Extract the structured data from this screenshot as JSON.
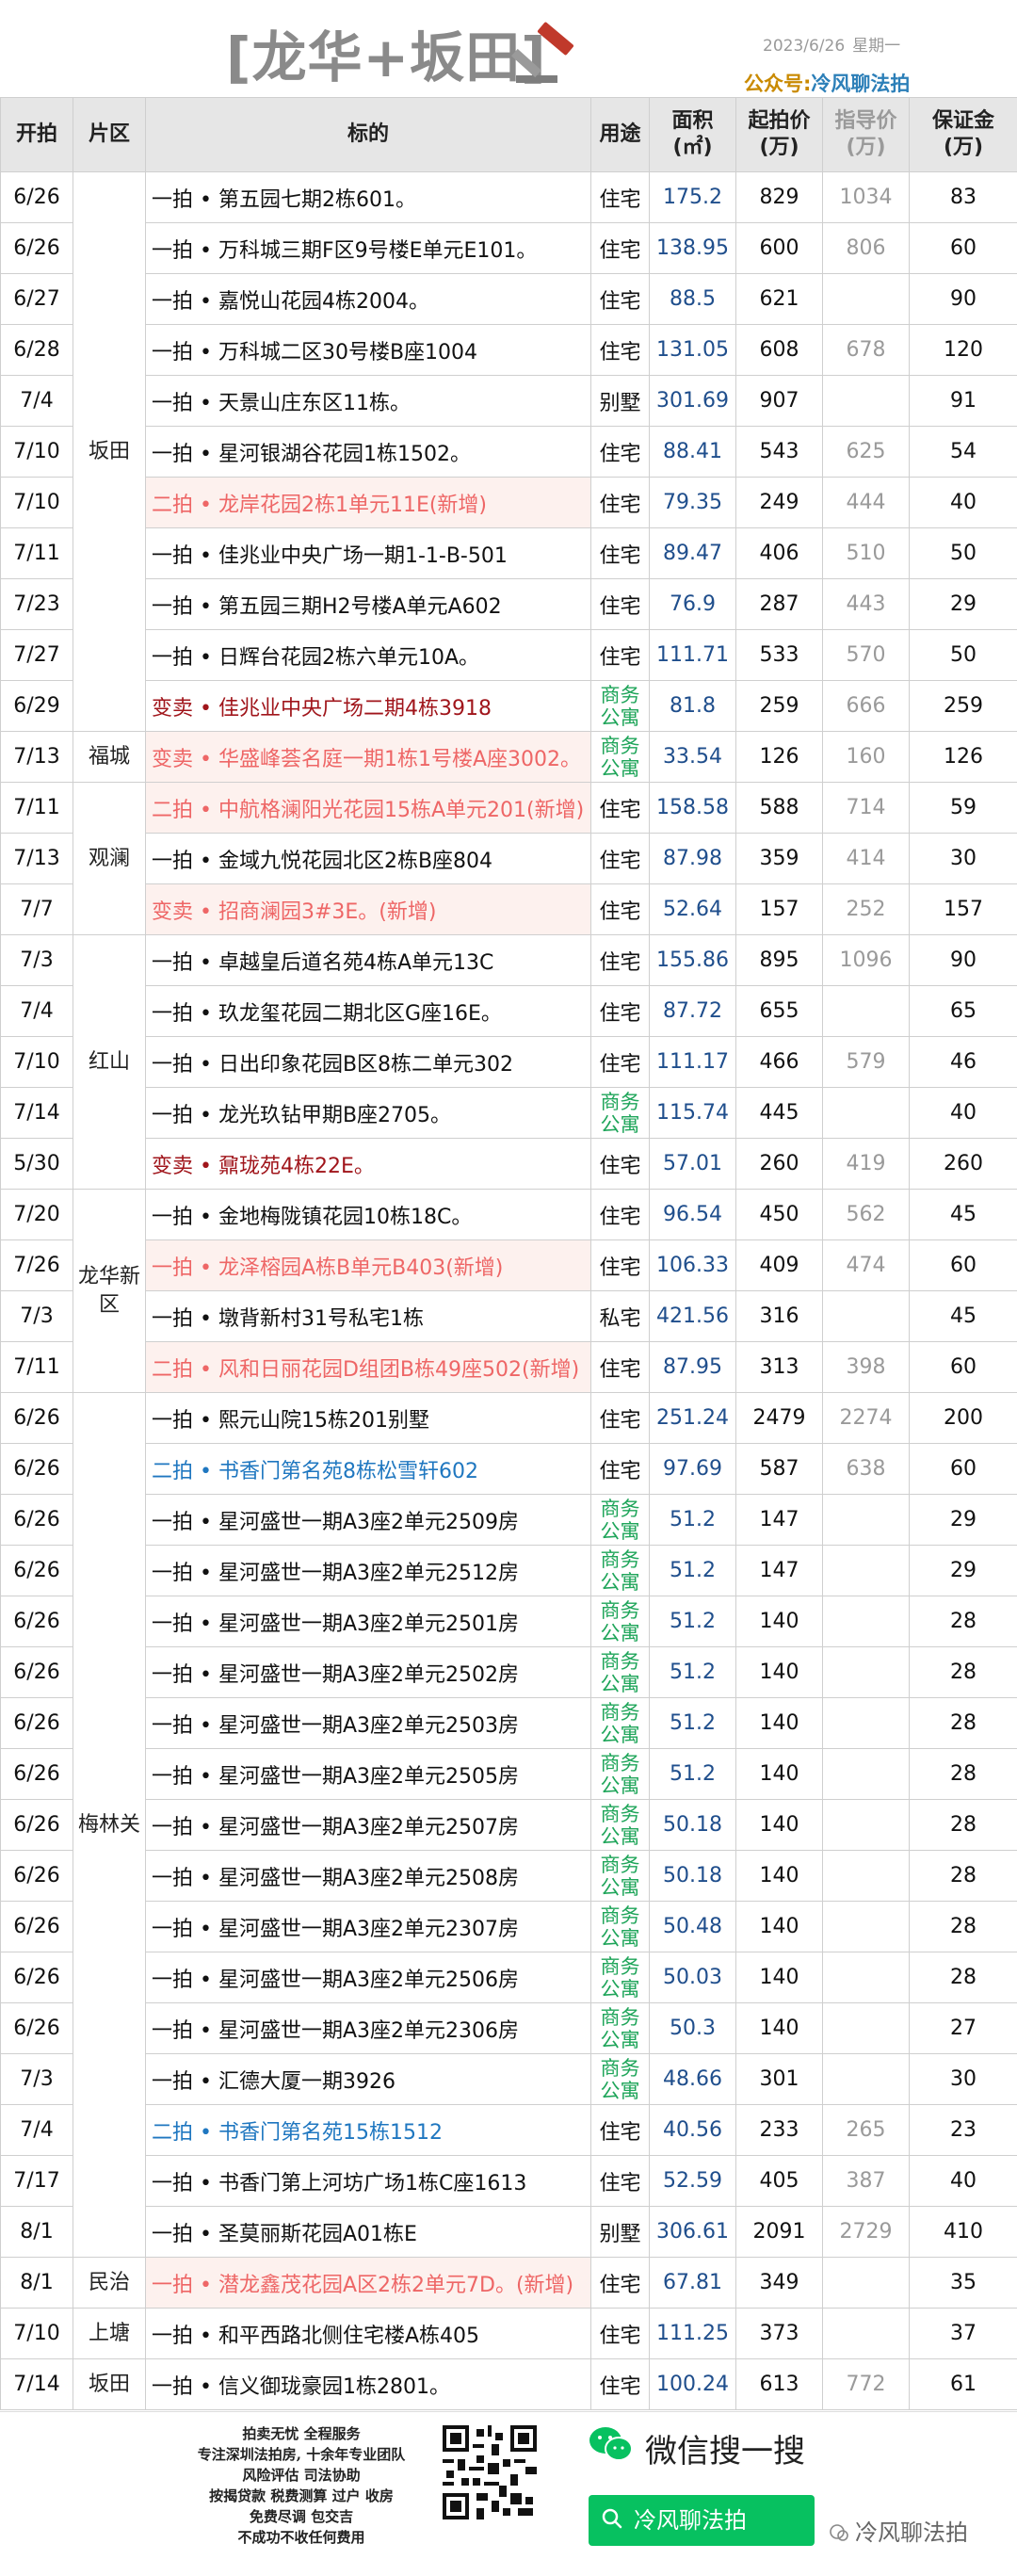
{
  "header": {
    "title": "[龙华+坂田]",
    "date": "2023/6/26",
    "weekday": "星期一",
    "gzh_label": "公众号:",
    "gzh_name": "冷风聊法拍"
  },
  "table": {
    "headers": {
      "date": "开拍",
      "zone": "片区",
      "name": "标的",
      "use": "用途",
      "area": "面积",
      "area_unit": "(㎡)",
      "price": "起拍价",
      "price_unit": "(万)",
      "guide": "指导价",
      "guide_unit": "(万)",
      "deposit": "保证金",
      "deposit_unit": "(万)"
    },
    "rows": [
      {
        "date": "6/26",
        "name": "一拍 • 第五园七期2栋601。",
        "use": "住宅",
        "area": "175.2",
        "price": "829",
        "guide": "1034",
        "deposit": "83",
        "style": ""
      },
      {
        "date": "6/26",
        "name": "一拍 • 万科城三期F区9号楼E单元E101。",
        "use": "住宅",
        "area": "138.95",
        "price": "600",
        "guide": "806",
        "deposit": "60",
        "style": ""
      },
      {
        "date": "6/27",
        "name": "一拍 • 嘉悦山花园4栋2004。",
        "use": "住宅",
        "area": "88.5",
        "price": "621",
        "guide": "",
        "deposit": "90",
        "style": ""
      },
      {
        "date": "6/28",
        "name": "一拍 • 万科城二区30号楼B座1004",
        "use": "住宅",
        "area": "131.05",
        "price": "608",
        "guide": "678",
        "deposit": "120",
        "style": ""
      },
      {
        "date": "7/4",
        "name": "一拍 • 天景山庄东区11栋。",
        "use": "别墅",
        "area": "301.69",
        "price": "907",
        "guide": "",
        "deposit": "91",
        "style": ""
      },
      {
        "date": "7/10",
        "name": "一拍 • 星河银湖谷花园1栋1502。",
        "use": "住宅",
        "area": "88.41",
        "price": "543",
        "guide": "625",
        "deposit": "54",
        "style": ""
      },
      {
        "date": "7/10",
        "name": "二拍 • 龙岸花园2栋1单元11E(新增)",
        "use": "住宅",
        "area": "79.35",
        "price": "249",
        "guide": "444",
        "deposit": "40",
        "style": "red"
      },
      {
        "date": "7/11",
        "name": "一拍 • 佳兆业中央广场一期1-1-B-501",
        "use": "住宅",
        "area": "89.47",
        "price": "406",
        "guide": "510",
        "deposit": "50",
        "style": ""
      },
      {
        "date": "7/23",
        "name": "一拍 • 第五园三期H2号楼A单元A602",
        "use": "住宅",
        "area": "76.9",
        "price": "287",
        "guide": "443",
        "deposit": "29",
        "style": ""
      },
      {
        "date": "7/27",
        "name": "一拍 • 日辉台花园2栋六单元10A。",
        "use": "住宅",
        "area": "111.71",
        "price": "533",
        "guide": "570",
        "deposit": "50",
        "style": ""
      },
      {
        "date": "6/29",
        "name": "变卖 • 佳兆业中央广场二期4栋3918",
        "use": "商务公寓",
        "area": "81.8",
        "price": "259",
        "guide": "666",
        "deposit": "259",
        "style": "dark"
      },
      {
        "date": "7/13",
        "name": "变卖 • 华盛峰荟名庭一期1栋1号楼A座3002。",
        "use": "商务公寓",
        "area": "33.54",
        "price": "126",
        "guide": "160",
        "deposit": "126",
        "style": "red"
      },
      {
        "date": "7/11",
        "name": "二拍 • 中航格澜阳光花园15栋A单元201(新增)",
        "use": "住宅",
        "area": "158.58",
        "price": "588",
        "guide": "714",
        "deposit": "59",
        "style": "red"
      },
      {
        "date": "7/13",
        "name": "一拍 • 金域九悦花园北区2栋B座804",
        "use": "住宅",
        "area": "87.98",
        "price": "359",
        "guide": "414",
        "deposit": "30",
        "style": ""
      },
      {
        "date": "7/7",
        "name": "变卖 • 招商澜园3#3E。(新增)",
        "use": "住宅",
        "area": "52.64",
        "price": "157",
        "guide": "252",
        "deposit": "157",
        "style": "red"
      },
      {
        "date": "7/3",
        "name": "一拍 • 卓越皇后道名苑4栋A单元13C",
        "use": "住宅",
        "area": "155.86",
        "price": "895",
        "guide": "1096",
        "deposit": "90",
        "style": ""
      },
      {
        "date": "7/4",
        "name": "一拍 • 玖龙玺花园二期北区G座16E。",
        "use": "住宅",
        "area": "87.72",
        "price": "655",
        "guide": "",
        "deposit": "65",
        "style": ""
      },
      {
        "date": "7/10",
        "name": "一拍 • 日出印象花园B区8栋二单元302",
        "use": "住宅",
        "area": "111.17",
        "price": "466",
        "guide": "579",
        "deposit": "46",
        "style": ""
      },
      {
        "date": "7/14",
        "name": "一拍 • 龙光玖钻甲期B座2705。",
        "use": "商务公寓",
        "area": "115.74",
        "price": "445",
        "guide": "",
        "deposit": "40",
        "style": ""
      },
      {
        "date": "5/30",
        "name": "变卖 • 鼐珑苑4栋22E。",
        "use": "住宅",
        "area": "57.01",
        "price": "260",
        "guide": "419",
        "deposit": "260",
        "style": "dark"
      },
      {
        "date": "7/20",
        "name": "一拍 • 金地梅陇镇花园10栋18C。",
        "use": "住宅",
        "area": "96.54",
        "price": "450",
        "guide": "562",
        "deposit": "45",
        "style": ""
      },
      {
        "date": "7/26",
        "name": "一拍 • 龙泽榕园A栋B单元B403(新增)",
        "use": "住宅",
        "area": "106.33",
        "price": "409",
        "guide": "474",
        "deposit": "60",
        "style": "red"
      },
      {
        "date": "7/3",
        "name": "一拍 • 墩背新村31号私宅1栋",
        "use": "私宅",
        "area": "421.56",
        "price": "316",
        "guide": "",
        "deposit": "45",
        "style": ""
      },
      {
        "date": "7/11",
        "name": "二拍 • 风和日丽花园D组团B栋49座502(新增)",
        "use": "住宅",
        "area": "87.95",
        "price": "313",
        "guide": "398",
        "deposit": "60",
        "style": "red"
      },
      {
        "date": "6/26",
        "name": "一拍 • 熙元山院15栋201别墅",
        "use": "住宅",
        "area": "251.24",
        "price": "2479",
        "guide": "2274",
        "deposit": "200",
        "style": ""
      },
      {
        "date": "6/26",
        "name": "二拍 • 书香门第名苑8栋松雪轩602",
        "use": "住宅",
        "area": "97.69",
        "price": "587",
        "guide": "638",
        "deposit": "60",
        "style": "blue"
      },
      {
        "date": "6/26",
        "name": "一拍 • 星河盛世一期A3座2单元2509房",
        "use": "商务公寓",
        "area": "51.2",
        "price": "147",
        "guide": "",
        "deposit": "29",
        "style": ""
      },
      {
        "date": "6/26",
        "name": "一拍 • 星河盛世一期A3座2单元2512房",
        "use": "商务公寓",
        "area": "51.2",
        "price": "147",
        "guide": "",
        "deposit": "29",
        "style": ""
      },
      {
        "date": "6/26",
        "name": "一拍 • 星河盛世一期A3座2单元2501房",
        "use": "商务公寓",
        "area": "51.2",
        "price": "140",
        "guide": "",
        "deposit": "28",
        "style": ""
      },
      {
        "date": "6/26",
        "name": "一拍 • 星河盛世一期A3座2单元2502房",
        "use": "商务公寓",
        "area": "51.2",
        "price": "140",
        "guide": "",
        "deposit": "28",
        "style": ""
      },
      {
        "date": "6/26",
        "name": "一拍 • 星河盛世一期A3座2单元2503房",
        "use": "商务公寓",
        "area": "51.2",
        "price": "140",
        "guide": "",
        "deposit": "28",
        "style": ""
      },
      {
        "date": "6/26",
        "name": "一拍 • 星河盛世一期A3座2单元2505房",
        "use": "商务公寓",
        "area": "51.2",
        "price": "140",
        "guide": "",
        "deposit": "28",
        "style": ""
      },
      {
        "date": "6/26",
        "name": "一拍 • 星河盛世一期A3座2单元2507房",
        "use": "商务公寓",
        "area": "50.18",
        "price": "140",
        "guide": "",
        "deposit": "28",
        "style": ""
      },
      {
        "date": "6/26",
        "name": "一拍 • 星河盛世一期A3座2单元2508房",
        "use": "商务公寓",
        "area": "50.18",
        "price": "140",
        "guide": "",
        "deposit": "28",
        "style": ""
      },
      {
        "date": "6/26",
        "name": "一拍 • 星河盛世一期A3座2单元2307房",
        "use": "商务公寓",
        "area": "50.48",
        "price": "140",
        "guide": "",
        "deposit": "28",
        "style": ""
      },
      {
        "date": "6/26",
        "name": "一拍 • 星河盛世一期A3座2单元2506房",
        "use": "商务公寓",
        "area": "50.03",
        "price": "140",
        "guide": "",
        "deposit": "28",
        "style": ""
      },
      {
        "date": "6/26",
        "name": "一拍 • 星河盛世一期A3座2单元2306房",
        "use": "商务公寓",
        "area": "50.3",
        "price": "140",
        "guide": "",
        "deposit": "27",
        "style": ""
      },
      {
        "date": "7/3",
        "name": "一拍 • 汇德大厦一期3926",
        "use": "商务公寓",
        "area": "48.66",
        "price": "301",
        "guide": "",
        "deposit": "30",
        "style": ""
      },
      {
        "date": "7/4",
        "name": "二拍 • 书香门第名苑15栋1512",
        "use": "住宅",
        "area": "40.56",
        "price": "233",
        "guide": "265",
        "deposit": "23",
        "style": "blue"
      },
      {
        "date": "7/17",
        "name": "一拍 • 书香门第上河坊广场1栋C座1613",
        "use": "住宅",
        "area": "52.59",
        "price": "405",
        "guide": "387",
        "deposit": "40",
        "style": ""
      },
      {
        "date": "8/1",
        "name": "一拍 • 圣莫丽斯花园A01栋E",
        "use": "别墅",
        "area": "306.61",
        "price": "2091",
        "guide": "2729",
        "deposit": "410",
        "style": ""
      },
      {
        "date": "8/1",
        "name": "一拍 • 潜龙鑫茂花园A区2栋2单元7D。(新增)",
        "use": "住宅",
        "area": "67.81",
        "price": "349",
        "guide": "",
        "deposit": "35",
        "style": "red"
      },
      {
        "date": "7/10",
        "name": "一拍 • 和平西路北侧住宅楼A栋405",
        "use": "住宅",
        "area": "111.25",
        "price": "373",
        "guide": "",
        "deposit": "37",
        "style": ""
      },
      {
        "date": "7/14",
        "name": "一拍 • 信义御珑豪园1栋2801。",
        "use": "住宅",
        "area": "100.24",
        "price": "613",
        "guide": "772",
        "deposit": "61",
        "style": ""
      }
    ],
    "zones": [
      {
        "label": "坂田",
        "start": 0,
        "span": 11
      },
      {
        "label": "福城",
        "start": 11,
        "span": 1
      },
      {
        "label": "观澜",
        "start": 12,
        "span": 3
      },
      {
        "label": "红山",
        "start": 15,
        "span": 5
      },
      {
        "label": "龙华新区",
        "start": 20,
        "span": 4
      },
      {
        "label": "梅林关",
        "start": 24,
        "span": 17
      },
      {
        "label": "民治",
        "start": 41,
        "span": 1
      },
      {
        "label": "上塘",
        "start": 42,
        "span": 1
      },
      {
        "label": "坂田",
        "start": 43,
        "span": 1
      }
    ]
  },
  "footer": {
    "lines": [
      "拍卖无忧 全程服务",
      "专注深圳法拍房, 十余年专业团队",
      "风险评估 司法协助",
      "按揭贷款 税费测算 过户 收房",
      "免费尽调 包交吉",
      "不成功不收任何费用"
    ],
    "wechat_title": "微信搜一搜",
    "search_label": "冷风聊法拍",
    "watermark": "冷风聊法拍"
  },
  "colors": {
    "header_bg": "#e6e6e6",
    "red_text": "#ee6666",
    "red_bg": "#fdf1ee",
    "dark_red": "#a0151b",
    "blue": "#1f77c0",
    "green": "#1fa55a",
    "area_blue": "#1f4e8c",
    "wechat_green": "#07c160"
  },
  "icons": [
    "gavel-icon",
    "qr-code",
    "wechat-icon",
    "search-icon"
  ]
}
